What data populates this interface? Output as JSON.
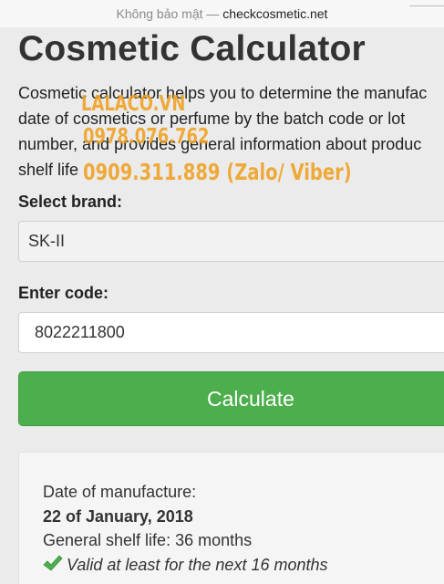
{
  "browser": {
    "security_label": "Không bảo mật —",
    "domain": "checkcosmetic.net"
  },
  "page": {
    "title": "Cosmetic Calculator",
    "intro_lines": [
      "Cosmetic calculator helps you to determine the manufac",
      "date of cosmetics or perfume by the batch code or lot",
      "number, and provides general information about produc",
      "shelf life"
    ]
  },
  "watermark": {
    "line1": "LALACO.VN",
    "line2": "0978.076.762",
    "line3": "0909.311.889 (Zalo/ Viber)",
    "color": "#f0a021"
  },
  "form": {
    "brand_label": "Select brand:",
    "brand_value": "SK-II",
    "code_label": "Enter code:",
    "code_value": "8022211800",
    "submit_label": "Calculate",
    "button_color": "#4cae4c"
  },
  "result": {
    "manufacture_label": "Date of manufacture:",
    "manufacture_date": "22 of January, 2018",
    "shelf_life": "General shelf life: 36 months",
    "validity": "Valid at least for the next 16 months",
    "status_icon": "check-icon",
    "status_color": "#4cae4c"
  }
}
